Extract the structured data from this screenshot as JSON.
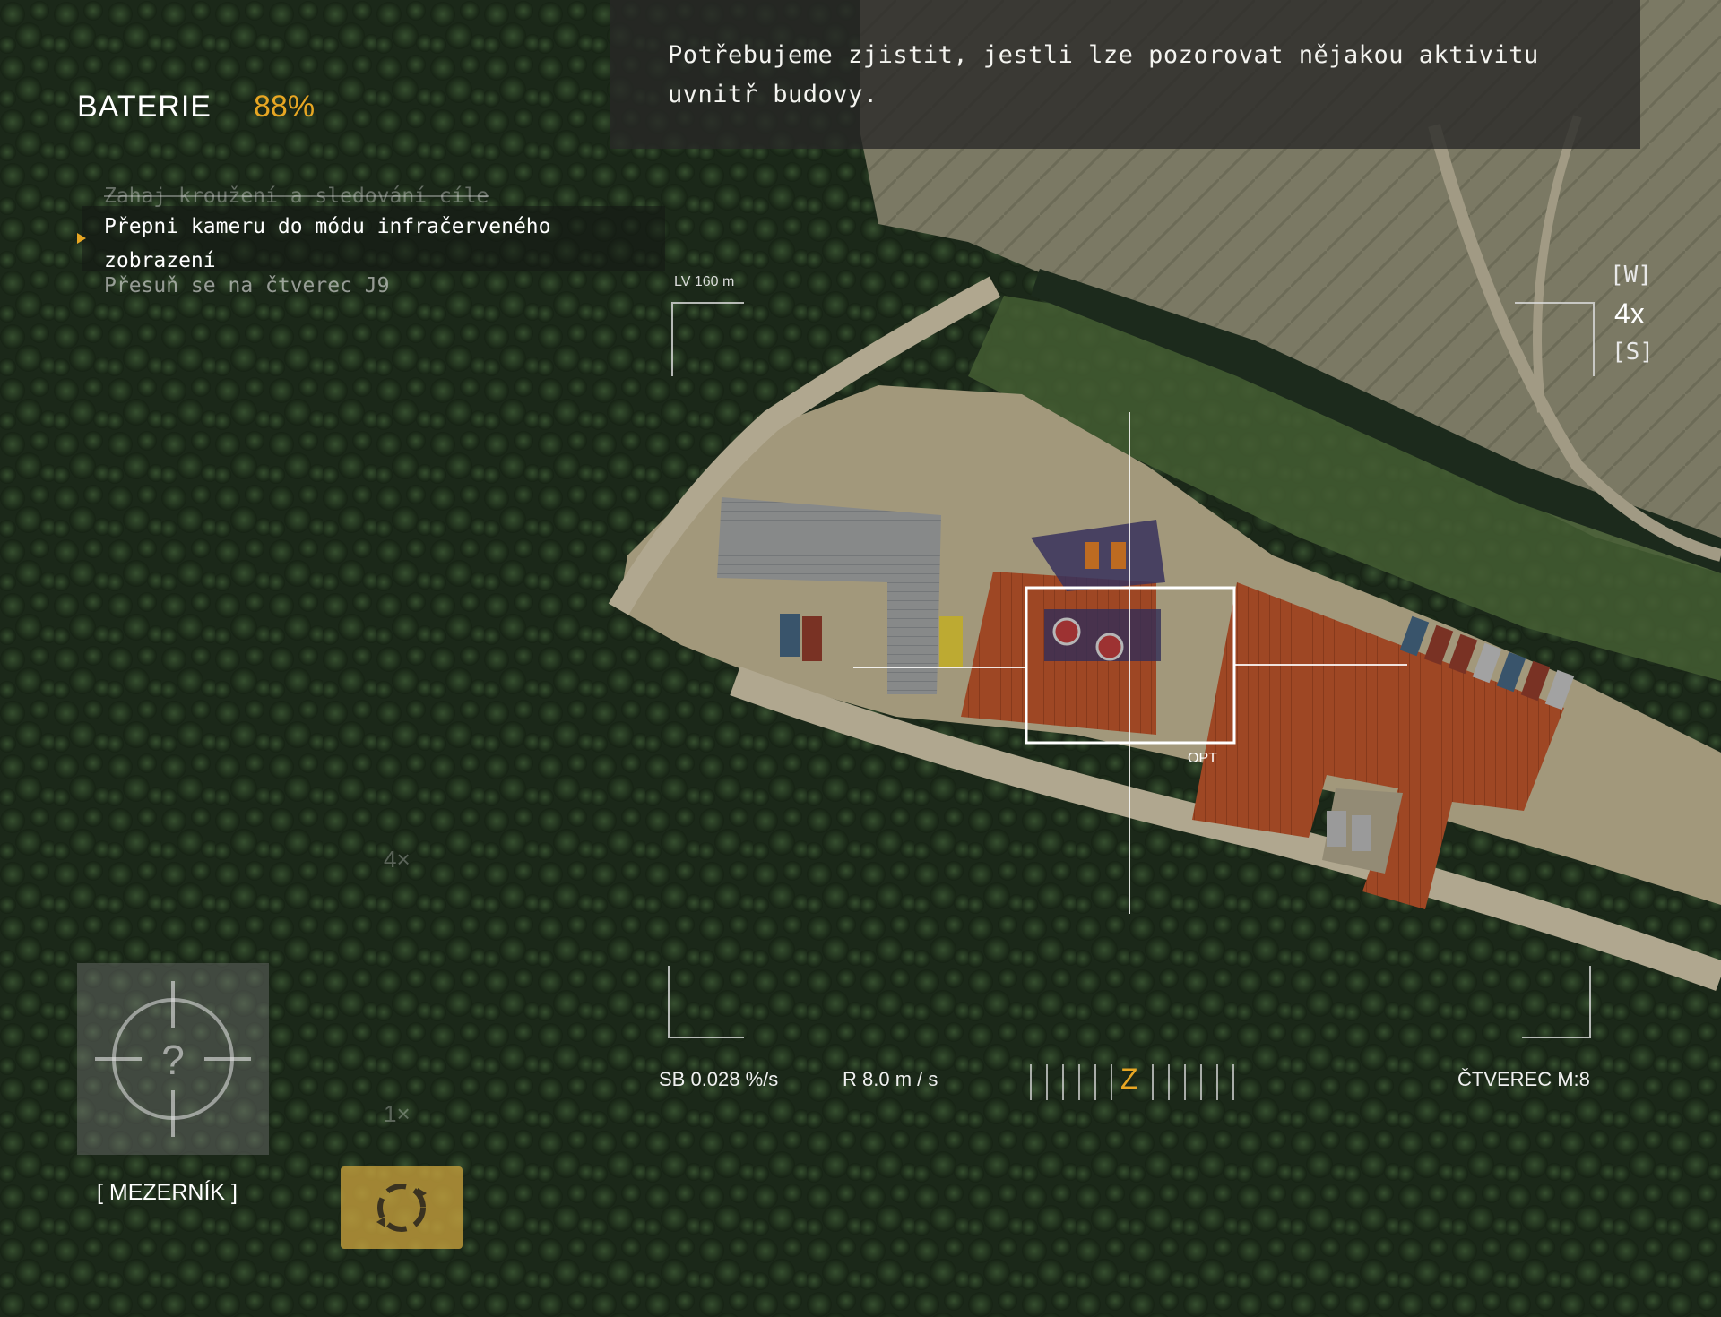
{
  "objective": {
    "text": "Potřebujeme zjistit, jestli lze pozorovat nějakou aktivitu uvnitř budovy."
  },
  "battery": {
    "label": "BATERIE",
    "value": "88%",
    "level": 0.88
  },
  "tasks": {
    "completed": "Zahaj kroužení a sledování cíle",
    "active": "Přepni kameru do módu infračerveného zobrazení",
    "next": "Přesuň se na čtverec J9"
  },
  "camera": {
    "zoom_top": "[W]",
    "zoom_level": "4x",
    "zoom_bottom": "[S]",
    "lv_readout": "LV 160 m",
    "opt_label": "OPT",
    "ghost_zoom_high": "4×",
    "ghost_zoom_low": "1×"
  },
  "telemetry": {
    "sb": "SB 0.028 %/s",
    "r": "R 8.0 m / s",
    "heading": "Z",
    "ctverec": "ČTVEREC M:8"
  },
  "controls": {
    "target_key": "[ MEZERNÍK ]",
    "target_icon": "crosshair-question-icon",
    "scan_icon": "rotate-scan-icon"
  },
  "colors": {
    "accent": "#e7a623",
    "hud_text": "#f2f2f2",
    "roof_orange": "#b8532a",
    "forest": "#223321"
  }
}
